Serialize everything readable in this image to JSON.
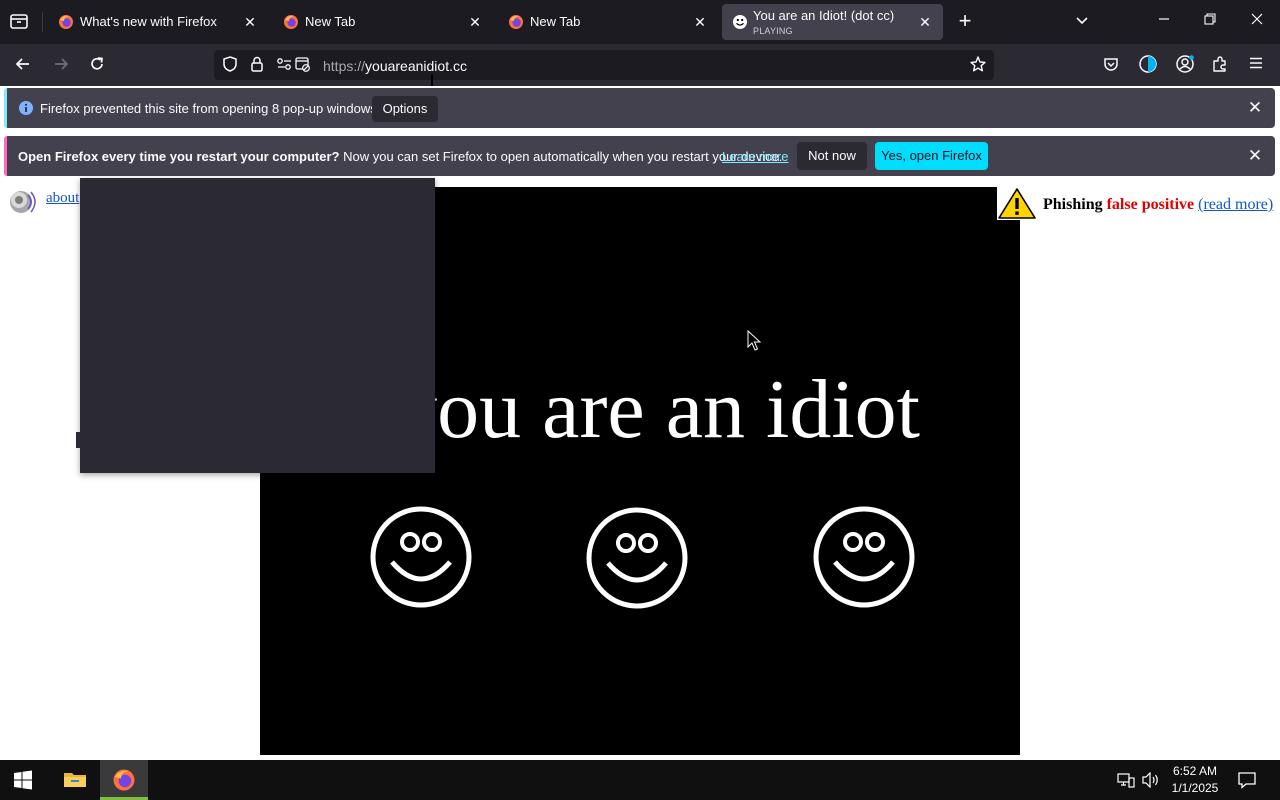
{
  "tabs": [
    {
      "title": "What's new with Firefox",
      "close": "✕"
    },
    {
      "title": "New Tab",
      "close": "✕"
    },
    {
      "title": "New Tab",
      "close": "✕"
    },
    {
      "title": "You are an Idiot! (dot cc)",
      "subtitle": "PLAYING",
      "close": "✕",
      "active": true
    }
  ],
  "toolbar": {
    "new_tab": "+",
    "list_all_tabs": "⌄",
    "minimize": "—",
    "restore": "❐",
    "close": "✕"
  },
  "navbar": {
    "url_scheme": "https://",
    "url_host": "youareanidiot.cc"
  },
  "popup_notification": {
    "message": "Firefox prevented this site from opening 8 pop-up windows.",
    "options_label": "Options",
    "close": "✕",
    "accent_color": "#80ebff"
  },
  "restart_notification": {
    "bold_text": "Open Firefox every time you restart your computer?",
    "message": " Now you can set Firefox to open automatically when you restart your device.",
    "link_text": "Learn more",
    "not_now_label": "Not now",
    "yes_label": "Yes, open Firefox",
    "close": "✕",
    "accent_color": "#ff6bba"
  },
  "page": {
    "about_link": "about",
    "headline": "you are an idiot",
    "phishing_label": "Phishing",
    "false_positive": "false positive",
    "read_more": "(read more)"
  },
  "taskbar": {
    "time": "6:52 AM",
    "date": "1/1/2025"
  },
  "colors": {
    "chrome_dark": "#1c1b22",
    "navbar": "#2b2a33",
    "accent_cyan": "#00ddff",
    "phishing_red": "#e00000"
  }
}
